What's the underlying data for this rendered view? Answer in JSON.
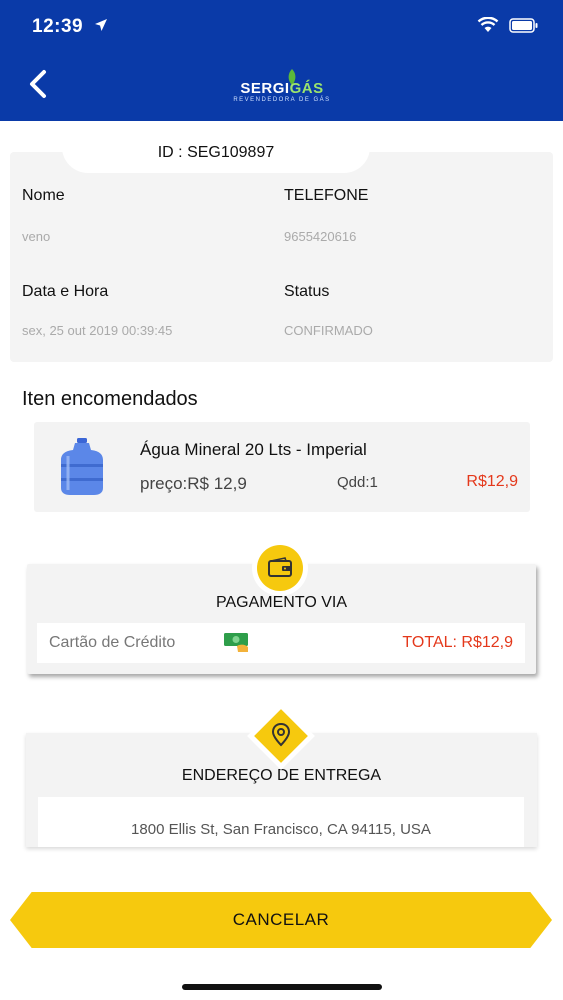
{
  "status_bar": {
    "time": "12:39"
  },
  "header": {
    "logo_text_a": "SERGI",
    "logo_text_b": "GÁS",
    "logo_subtitle": "REVENDEDORA DE GÁS"
  },
  "order": {
    "id_label": "ID : SEG109897",
    "name_label": "Nome",
    "name_value": "veno",
    "phone_label": "TELEFONE",
    "phone_value": "9655420616",
    "datetime_label": "Data e Hora",
    "datetime_value": "sex, 25 out 2019 00:39:45",
    "status_label": "Status",
    "status_value": "CONFIRMADO"
  },
  "items_section": {
    "title": "Iten encomendados",
    "items": [
      {
        "name": "Água Mineral 20 Lts - Imperial",
        "price": "preço:R$ 12,9",
        "qty": "Qdd:1",
        "total": "R$12,9"
      }
    ]
  },
  "payment": {
    "title": "PAGAMENTO VIA",
    "method": "Cartão de Crédito",
    "total": "TOTAL: R$12,9",
    "icon": "wallet-icon"
  },
  "delivery": {
    "title": "ENDEREÇO DE ENTREGA",
    "address": "1800 Ellis St, San Francisco, CA 94115, USA",
    "icon": "location-pin-icon"
  },
  "actions": {
    "cancel_label": "CANCELAR"
  },
  "colors": {
    "header_blue": "#0a3aa8",
    "accent_yellow": "#f6c90e",
    "price_red": "#e4381b"
  }
}
